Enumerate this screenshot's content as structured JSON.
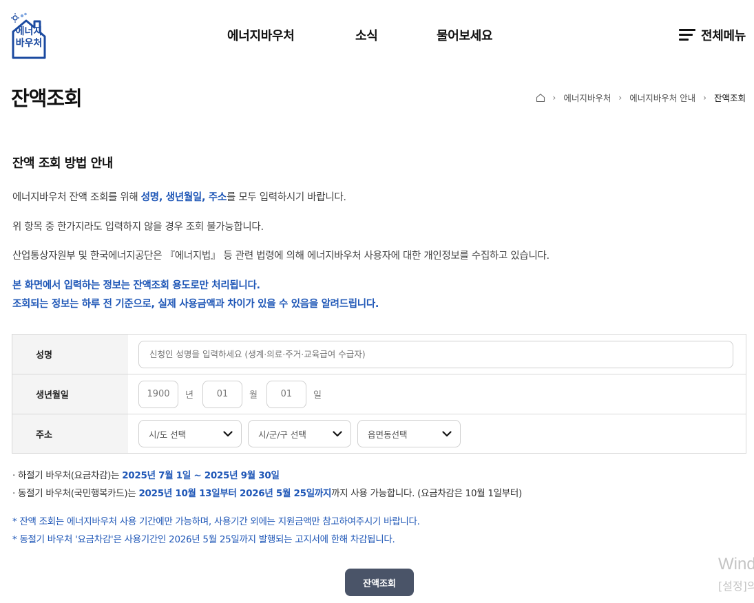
{
  "header": {
    "logo_text_line1": "에너지",
    "logo_text_line2": "바우처",
    "nav": [
      "에너지바우처",
      "소식",
      "물어보세요"
    ],
    "all_menu": "전체메뉴"
  },
  "page": {
    "title": "잔액조회",
    "breadcrumb": [
      "에너지바우처",
      "에너지바우처 안내",
      "잔액조회"
    ]
  },
  "guide": {
    "title": "잔액 조회 방법 안내",
    "line1_pre": "에너지바우처 잔액 조회를 위해 ",
    "line1_hl": "성명, 생년월일, 주소",
    "line1_post": "를 모두 입력하시기 바랍니다.",
    "line2": "위 항목 중 한가지라도 입력하지 않을 경우 조회 불가능합니다.",
    "line3": "산업통상자원부 및 한국에너지공단은 『에너지법』 등 관련 법령에 의해 에너지바우처 사용자에 대한 개인정보를 수집하고 있습니다.",
    "notice1": "본 화면에서 입력하는 정보는 잔액조회 용도로만 처리됩니다.",
    "notice2": "조회되는 정보는 하루 전 기준으로, 실제 사용금액과 차이가 있을 수 있음을 알려드립니다."
  },
  "form": {
    "name_label": "성명",
    "name_placeholder": "신청인 성명을 입력하세요 (생계·의료·주거·교육급여 수급자)",
    "birth_label": "생년월일",
    "birth_year": "1900",
    "year_unit": "년",
    "birth_month": "01",
    "month_unit": "월",
    "birth_day": "01",
    "day_unit": "일",
    "address_label": "주소",
    "sido": "시/도 선택",
    "sigungu": "시/군/구 선택",
    "eupmyeondong": "읍면동선택"
  },
  "info": {
    "summer_pre": "· 하절기 바우처(요금차감)는 ",
    "summer_period": "2025년 7월 1일 ~ 2025년 9월 30일",
    "winter_pre": "· 동절기 바우처(국민행복카드)는 ",
    "winter_period": "2025년 10월 13일부터 2026년 5월 25일까지",
    "winter_post": "까지 사용 가능합니다. (요금차감은 10월 1일부터)",
    "note1": "* 잔액 조회는 에너지바우처 사용 기간에만 가능하며, 사용기간 외에는 지원금액만 참고하여주시기 바랍니다.",
    "note2": "* 동절기 바우처 '요금차감'은 사용기간인 2026년 5월 25일까지 발행되는 고지서에 한해 차감됩니다."
  },
  "submit_label": "잔액조회",
  "watermark": {
    "line1": "Wind",
    "line2": "[설정]의"
  },
  "colors": {
    "accent": "#1f57b7",
    "button": "#4a5468"
  }
}
